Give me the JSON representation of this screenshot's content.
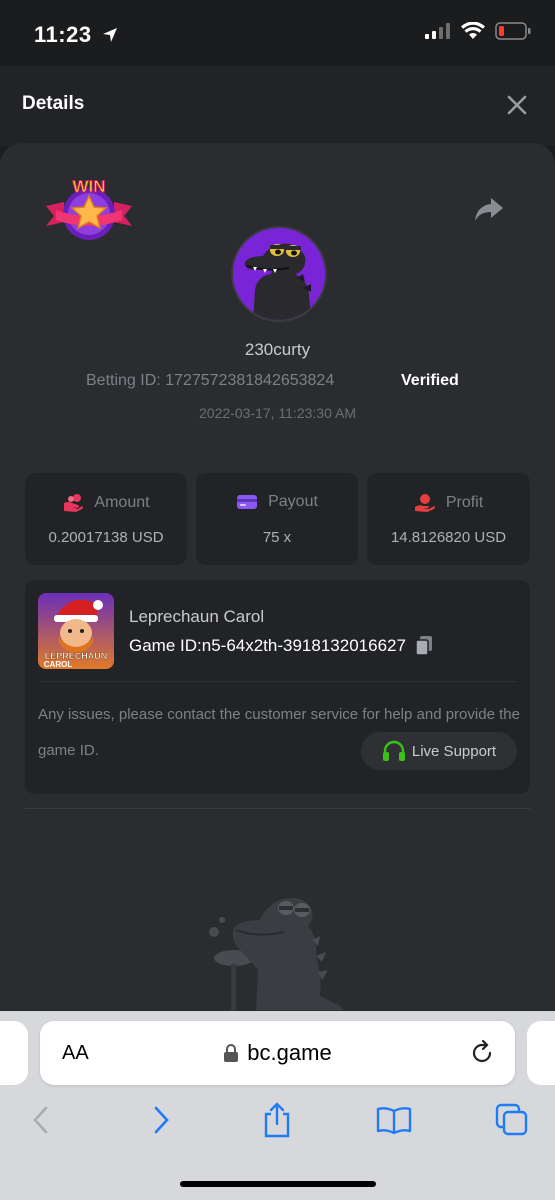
{
  "status": {
    "time": "11:23"
  },
  "header": {
    "title": "Details"
  },
  "bet": {
    "username": "230curty",
    "betting_id_label": "Betting ID:",
    "betting_id": "1727572381842653824",
    "verified": "Verified",
    "datetime": "2022-03-17, 11:23:30 AM",
    "badge_text": "WIN"
  },
  "stats": [
    {
      "label": "Amount",
      "value": "0.20017138 USD"
    },
    {
      "label": "Payout",
      "value": "75 x"
    },
    {
      "label": "Profit",
      "value": "14.8126820 USD"
    }
  ],
  "game": {
    "name": "Leprechaun Carol",
    "id_label": "Game ID:",
    "id": "n5-64x2th-3918132016627",
    "thumb_text_1": "LEPRECHAUN",
    "thumb_text_2": "CAROL",
    "notice": "Any issues, please contact the customer service for help and provide the game ID.",
    "support_label": "Live Support"
  },
  "browser": {
    "aa": "AA",
    "domain": "bc.game"
  },
  "colors": {
    "accent_green": "#3bc117",
    "amount_icon": "#e8375e",
    "payout_icon": "#8a57f5",
    "profit_icon": "#e63d3d",
    "avatar": "#7a24d8",
    "ios_blue": "#1f7cf5"
  }
}
